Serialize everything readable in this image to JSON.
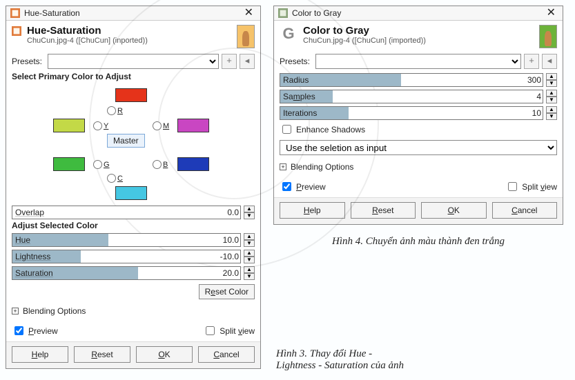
{
  "hue": {
    "title": "Hue-Saturation",
    "header_title": "Hue-Saturation",
    "header_sub": "ChuCun.jpg-4 ([ChuCun] (inported))",
    "presets_label": "Presets:",
    "select_primary": "Select Primary Color to Adjust",
    "colors": {
      "R": "R",
      "Y": "Y",
      "G": "G",
      "C": "C",
      "B": "B",
      "M": "M"
    },
    "master": "Master",
    "overlap_label": "Overlap",
    "overlap_value": "0.0",
    "adjust_selected": "Adjust Selected Color",
    "hue_label": "Hue",
    "hue_value": "10.0",
    "lightness_label": "Lightness",
    "lightness_value": "-10.0",
    "saturation_label": "Saturation",
    "saturation_value": "20.0",
    "reset_color": "Reset Color",
    "blending": "Blending Options",
    "preview": "Preview",
    "split_view": "Split view",
    "help": "Help",
    "reset": "Reset",
    "ok": "OK",
    "cancel": "Cancel"
  },
  "gray": {
    "title": "Color to Gray",
    "header_title": "Color to Gray",
    "header_sub": "ChuCun.jpg-4 ([ChuCun] (imported))",
    "presets_label": "Presets:",
    "radius_label": "Radius",
    "radius_value": "300",
    "samples_label": "Samples",
    "samples_value": "4",
    "iterations_label": "Iterations",
    "iterations_value": "10",
    "enhance_shadows": "Enhance Shadows",
    "use_selection": "Use the seletion as input",
    "blending": "Blending Options",
    "preview": "Preview",
    "split_view": "Split view",
    "help": "Help",
    "reset": "Reset",
    "ok": "OK",
    "cancel": "Cancel"
  },
  "captions": {
    "fig4": "Hình 4. Chuyển ảnh màu thành đen trắng",
    "fig3a": "Hình 3. Thay đổi Hue -",
    "fig3b": "Lightness - Saturation của ảnh"
  }
}
